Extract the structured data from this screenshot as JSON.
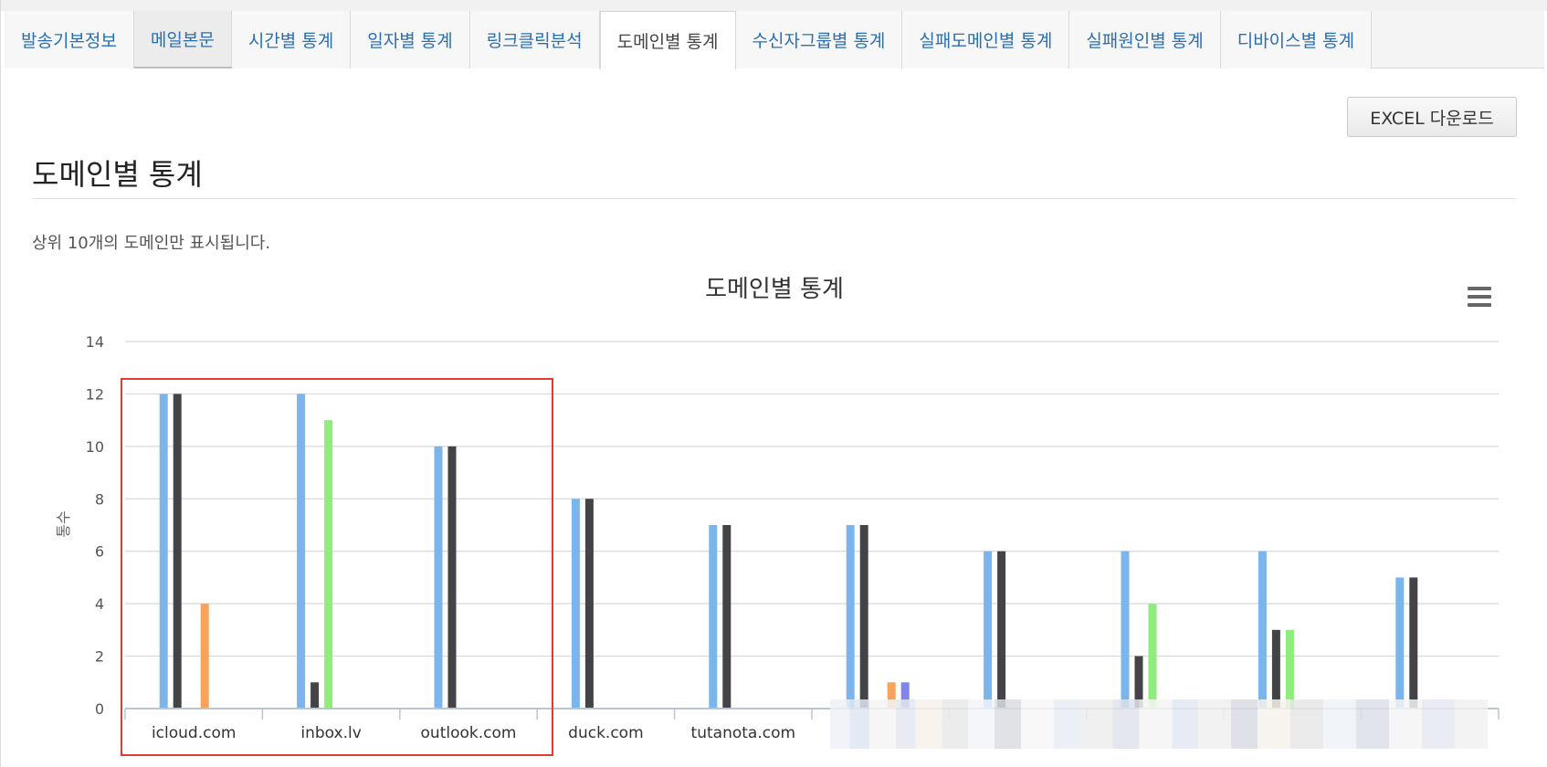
{
  "tabs": [
    {
      "label": "발송기본정보"
    },
    {
      "label": "메일본문"
    },
    {
      "label": "시간별 통계"
    },
    {
      "label": "일자별 통계"
    },
    {
      "label": "링크클릭분석"
    },
    {
      "label": "도메인별 통계"
    },
    {
      "label": "수신자그룹별 통계"
    },
    {
      "label": "실패도메인별 통계"
    },
    {
      "label": "실패원인별 통계"
    },
    {
      "label": "디바이스별 통계"
    }
  ],
  "active_tab": "도메인별 통계",
  "excel_button": "EXCEL 다운로드",
  "section_title": "도메인별 통계",
  "notice": "상위 10개의 도메인만 표시됩니다.",
  "chart_data": {
    "type": "bar",
    "title": "도메인별 통계",
    "ylabel": "통수",
    "xlabel": "",
    "ylim": [
      0,
      14
    ],
    "yticks": [
      0,
      2,
      4,
      6,
      8,
      10,
      12,
      14
    ],
    "grid": true,
    "categories": [
      "icloud.com",
      "inbox.lv",
      "outlook.com",
      "duck.com",
      "tutanota.com",
      "",
      "",
      "",
      "",
      ""
    ],
    "series": [
      {
        "color": "#7cb5ec",
        "values": [
          12,
          12,
          10,
          8,
          7,
          7,
          6,
          6,
          6,
          5
        ]
      },
      {
        "color": "#434348",
        "values": [
          12,
          1,
          10,
          8,
          7,
          7,
          6,
          2,
          3,
          5
        ]
      },
      {
        "color": "#90ed7d",
        "values": [
          0,
          11,
          0,
          0,
          0,
          0,
          0,
          4,
          3,
          0
        ]
      },
      {
        "color": "#f7a35c",
        "values": [
          4,
          0,
          0,
          0,
          0,
          1,
          0,
          0,
          0,
          0
        ]
      },
      {
        "color": "#8085e9",
        "values": [
          0,
          0,
          0,
          0,
          0,
          1,
          0,
          0,
          0,
          0
        ]
      }
    ]
  }
}
